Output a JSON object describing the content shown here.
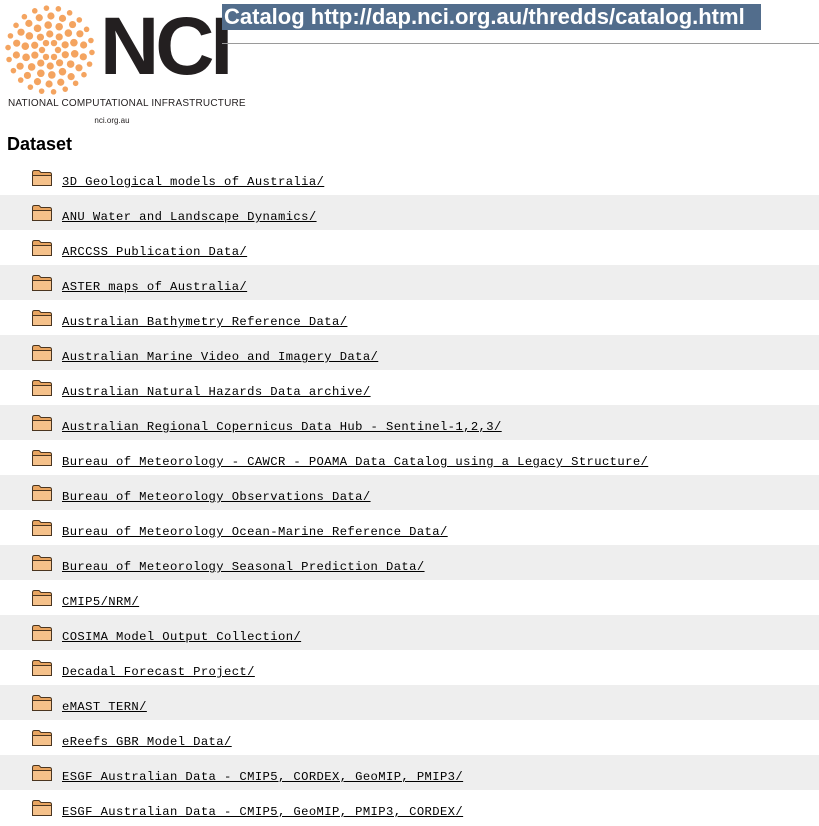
{
  "logo": {
    "wordmark": "NCI",
    "subtitle": "NATIONAL COMPUTATIONAL INFRASTRUCTURE",
    "url": "nci.org.au",
    "icon": "nci-sunburst-logo"
  },
  "header": {
    "title": "Catalog http://dap.nci.org.au/thredds/catalog.html"
  },
  "section": {
    "heading": "Dataset"
  },
  "colors": {
    "title_bg": "#526d8c",
    "row_alt_bg": "#eeeeee",
    "folder_fill": "#f5c18a",
    "logo_orange": "#f4a460"
  },
  "datasets": [
    {
      "label": "3D Geological models of Australia/",
      "icon": "folder-icon"
    },
    {
      "label": "ANU Water and Landscape Dynamics/",
      "icon": "folder-icon"
    },
    {
      "label": "ARCCSS Publication Data/",
      "icon": "folder-icon"
    },
    {
      "label": "ASTER maps of Australia/",
      "icon": "folder-icon"
    },
    {
      "label": "Australian Bathymetry Reference Data/",
      "icon": "folder-icon"
    },
    {
      "label": "Australian Marine Video and Imagery Data/",
      "icon": "folder-icon"
    },
    {
      "label": "Australian Natural Hazards Data archive/",
      "icon": "folder-icon"
    },
    {
      "label": "Australian Regional Copernicus Data Hub - Sentinel-1,2,3/",
      "icon": "folder-icon"
    },
    {
      "label": "Bureau of Meteorology - CAWCR - POAMA Data Catalog using a Legacy Structure/",
      "icon": "folder-icon"
    },
    {
      "label": "Bureau of Meteorology Observations Data/",
      "icon": "folder-icon"
    },
    {
      "label": "Bureau of Meteorology Ocean-Marine Reference Data/",
      "icon": "folder-icon"
    },
    {
      "label": "Bureau of Meteorology Seasonal Prediction Data/",
      "icon": "folder-icon"
    },
    {
      "label": "CMIP5/NRM/",
      "icon": "folder-icon"
    },
    {
      "label": "COSIMA Model Output Collection/",
      "icon": "folder-icon"
    },
    {
      "label": "Decadal Forecast Project/",
      "icon": "folder-icon"
    },
    {
      "label": "eMAST TERN/",
      "icon": "folder-icon"
    },
    {
      "label": "eReefs GBR Model Data/",
      "icon": "folder-icon"
    },
    {
      "label": "ESGF Australian Data - CMIP5, CORDEX, GeoMIP, PMIP3/",
      "icon": "folder-icon"
    },
    {
      "label": "ESGF Australian Data - CMIP5, GeoMIP, PMIP3, CORDEX/",
      "icon": "folder-icon"
    }
  ]
}
